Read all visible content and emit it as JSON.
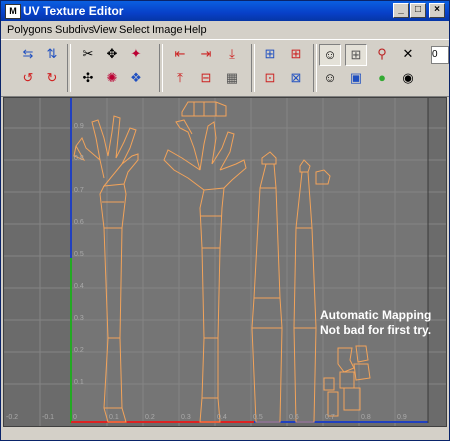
{
  "window": {
    "title": "UV Texture Editor",
    "minimize_label": "_",
    "maximize_label": "□",
    "close_label": "×"
  },
  "menu": [
    "Polygons",
    "Subdivs",
    "View",
    "Select",
    "Image",
    "Help"
  ],
  "toolbar": {
    "field_value": "0"
  },
  "annotation": {
    "line1": "Automatic Mapping",
    "line2": "Not bad for first try."
  },
  "axis": {
    "left_ticks": [
      "0.9",
      "0.8",
      "0.7",
      "0.6",
      "0.5",
      "0.4",
      "0.3",
      "0.2",
      "0.1"
    ],
    "bottom_ticks": [
      "-0.2",
      "-0.1",
      "0",
      "0.1",
      "0.2",
      "0.3",
      "0.4",
      "0.5",
      "0.6",
      "0.7",
      "0.8",
      "0.9"
    ]
  },
  "colors": {
    "uv_wire": "#f2a35a",
    "u_axis": "#d22",
    "v_axis": "#2a2",
    "border_axis": "#2040c0",
    "titlebar": "#0a5fe0"
  }
}
